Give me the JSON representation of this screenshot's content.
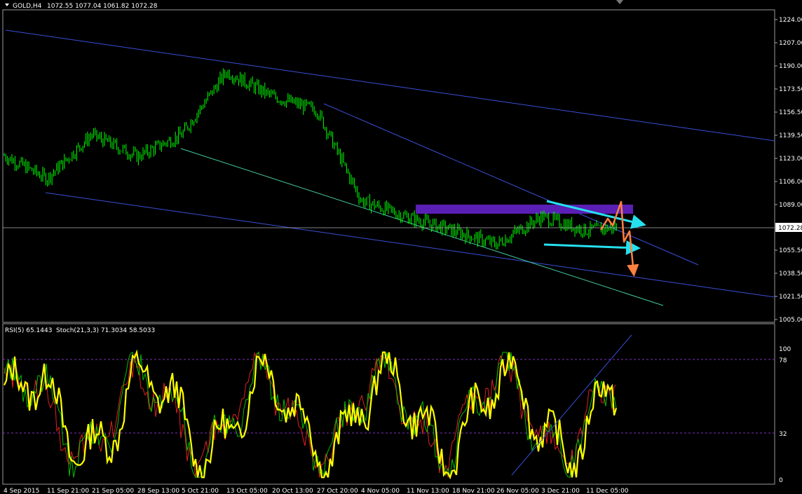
{
  "main_panel": {
    "symbol_label": "GOLD,H4",
    "ohlc_text": "1072.55 1077.04 1061.82 1072.28",
    "current_price_label": "1072.28",
    "price_ticks": [
      "1224.00",
      "1207.00",
      "1190.00",
      "1173.50",
      "1156.50",
      "1139.50",
      "1123.00",
      "1106.00",
      "1089.00",
      "1072.28",
      "1055.50",
      "1038.50",
      "1021.50",
      "1005.00"
    ]
  },
  "indicator_panel": {
    "label_rsi": "RSI(5) 65.1443",
    "label_stoch": "Stoch(21,3,3) 71.3034 58.5033",
    "ticks": [
      "100",
      "78",
      "32",
      "0"
    ]
  },
  "time_axis": {
    "labels": [
      "4 Sep 2015",
      "11 Sep 21:00",
      "21 Sep 05:00",
      "28 Sep 13:00",
      "5 Oct 21:00",
      "13 Oct 05:00",
      "20 Oct 13:00",
      "27 Oct 20:00",
      "4 Nov 05:00",
      "11 Nov 13:00",
      "18 Nov 21:00",
      "26 Nov 05:00",
      "3 Dec 21:00",
      "11 Dec 05:00"
    ]
  },
  "colors": {
    "background": "#000000",
    "candles": "#00ff00",
    "trendline": "#3a4fd8",
    "channel_low": "#43c9a0",
    "zone": "#5a1fb4",
    "cyan_arrow": "#26e0ee",
    "orange_arrow": "#ff8040",
    "rsi": "#ffff00",
    "stoch_main": "#00c000",
    "stoch_signal": "#e02020",
    "level_line": "#8030c0"
  },
  "chart_data": [
    {
      "type": "candlestick",
      "symbol": "GOLD",
      "timeframe": "H4",
      "ylim": [
        1005,
        1224
      ],
      "last": {
        "open": 1072.55,
        "high": 1077.04,
        "low": 1061.82,
        "close": 1072.28
      },
      "close_path": {
        "x": [
          "4 Sep 2015",
          "11 Sep 21:00",
          "21 Sep 05:00",
          "28 Sep 13:00",
          "5 Oct 21:00",
          "13 Oct 05:00",
          "20 Oct 13:00",
          "27 Oct 20:00",
          "4 Nov 05:00",
          "11 Nov 13:00",
          "18 Nov 21:00",
          "26 Nov 05:00",
          "3 Dec 21:00",
          "11 Dec 05:00"
        ],
        "y": [
          1125,
          1108,
          1140,
          1124,
          1140,
          1186,
          1168,
          1158,
          1092,
          1080,
          1070,
          1060,
          1080,
          1070
        ]
      },
      "annotations": {
        "resistance_zone": [
          1084.5,
          1091.5
        ]
      }
    },
    {
      "type": "line",
      "ylim": [
        0,
        100
      ],
      "levels": [
        78,
        32
      ],
      "series": [
        {
          "name": "RSI(5)",
          "last": 65.1443
        },
        {
          "name": "Stoch(21,3,3)",
          "last": [
            71.3034,
            58.5033
          ]
        }
      ]
    }
  ]
}
